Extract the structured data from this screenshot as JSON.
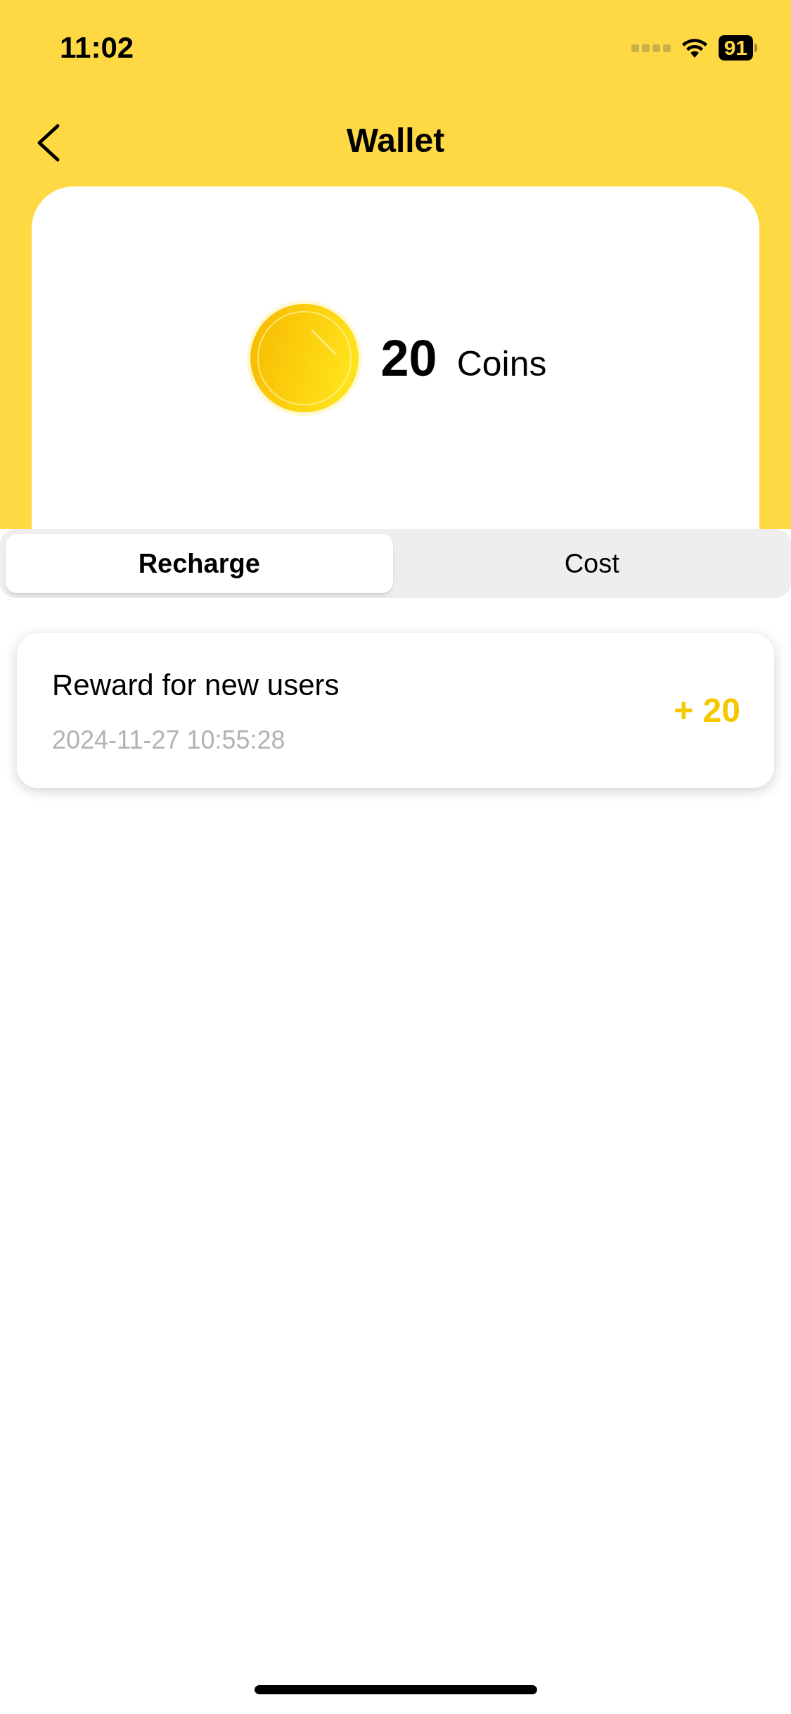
{
  "status_bar": {
    "time": "11:02",
    "battery": "91"
  },
  "nav": {
    "title": "Wallet"
  },
  "balance": {
    "amount": "20",
    "unit": "Coins"
  },
  "tabs": [
    {
      "label": "Recharge",
      "selected": true
    },
    {
      "label": "Cost",
      "selected": false
    }
  ],
  "records": [
    {
      "title": "Reward for new users",
      "time": "2024-11-27 10:55:28",
      "amount": "+ 20"
    }
  ]
}
